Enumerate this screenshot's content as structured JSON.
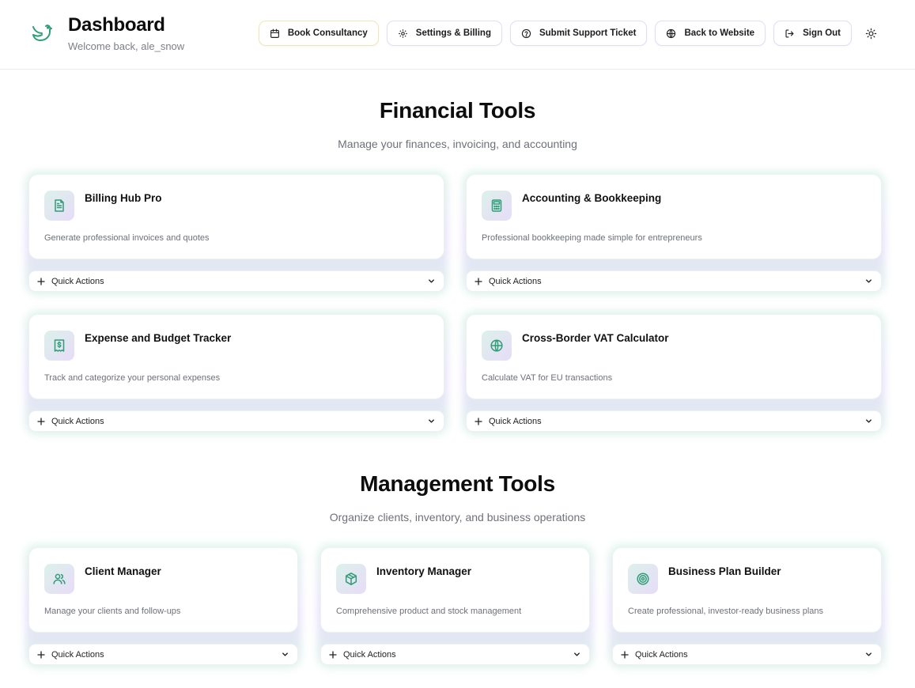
{
  "header": {
    "title": "Dashboard",
    "subtitle": "Welcome back, ale_snow",
    "nav": [
      {
        "label": "Book Consultancy",
        "icon": "calendar-icon"
      },
      {
        "label": "Settings & Billing",
        "icon": "gear-icon"
      },
      {
        "label": "Submit Support Ticket",
        "icon": "help-circle-icon"
      },
      {
        "label": "Back to Website",
        "icon": "globe-icon"
      },
      {
        "label": "Sign Out",
        "icon": "logout-icon"
      }
    ],
    "theme_icon": "sun-icon"
  },
  "financial": {
    "title": "Financial Tools",
    "subtitle": "Manage your finances, invoicing, and accounting",
    "cards": [
      {
        "name": "Billing Hub Pro",
        "desc": "Generate professional invoices and quotes",
        "icon": "document-icon",
        "qa": "Quick Actions"
      },
      {
        "name": "Accounting & Bookkeeping",
        "desc": "Professional bookkeeping made simple for entrepreneurs",
        "icon": "calculator-icon",
        "qa": "Quick Actions"
      },
      {
        "name": "Expense and Budget Tracker",
        "desc": "Track and categorize your personal expenses",
        "icon": "receipt-icon",
        "qa": "Quick Actions"
      },
      {
        "name": "Cross-Border VAT Calculator",
        "desc": "Calculate VAT for EU transactions",
        "icon": "globe-icon",
        "qa": "Quick Actions"
      }
    ]
  },
  "management": {
    "title": "Management Tools",
    "subtitle": "Organize clients, inventory, and business operations",
    "cards": [
      {
        "name": "Client Manager",
        "desc": "Manage your clients and follow-ups",
        "icon": "users-icon",
        "qa": "Quick Actions"
      },
      {
        "name": "Inventory Manager",
        "desc": "Comprehensive product and stock management",
        "icon": "package-icon",
        "qa": "Quick Actions"
      },
      {
        "name": "Business Plan Builder",
        "desc": "Create professional, investor-ready business plans",
        "icon": "target-icon",
        "qa": "Quick Actions"
      }
    ]
  },
  "colors": {
    "accent_green": "#2f9e77",
    "text_dark": "#0d0d0d",
    "text_muted": "#6d7178"
  }
}
